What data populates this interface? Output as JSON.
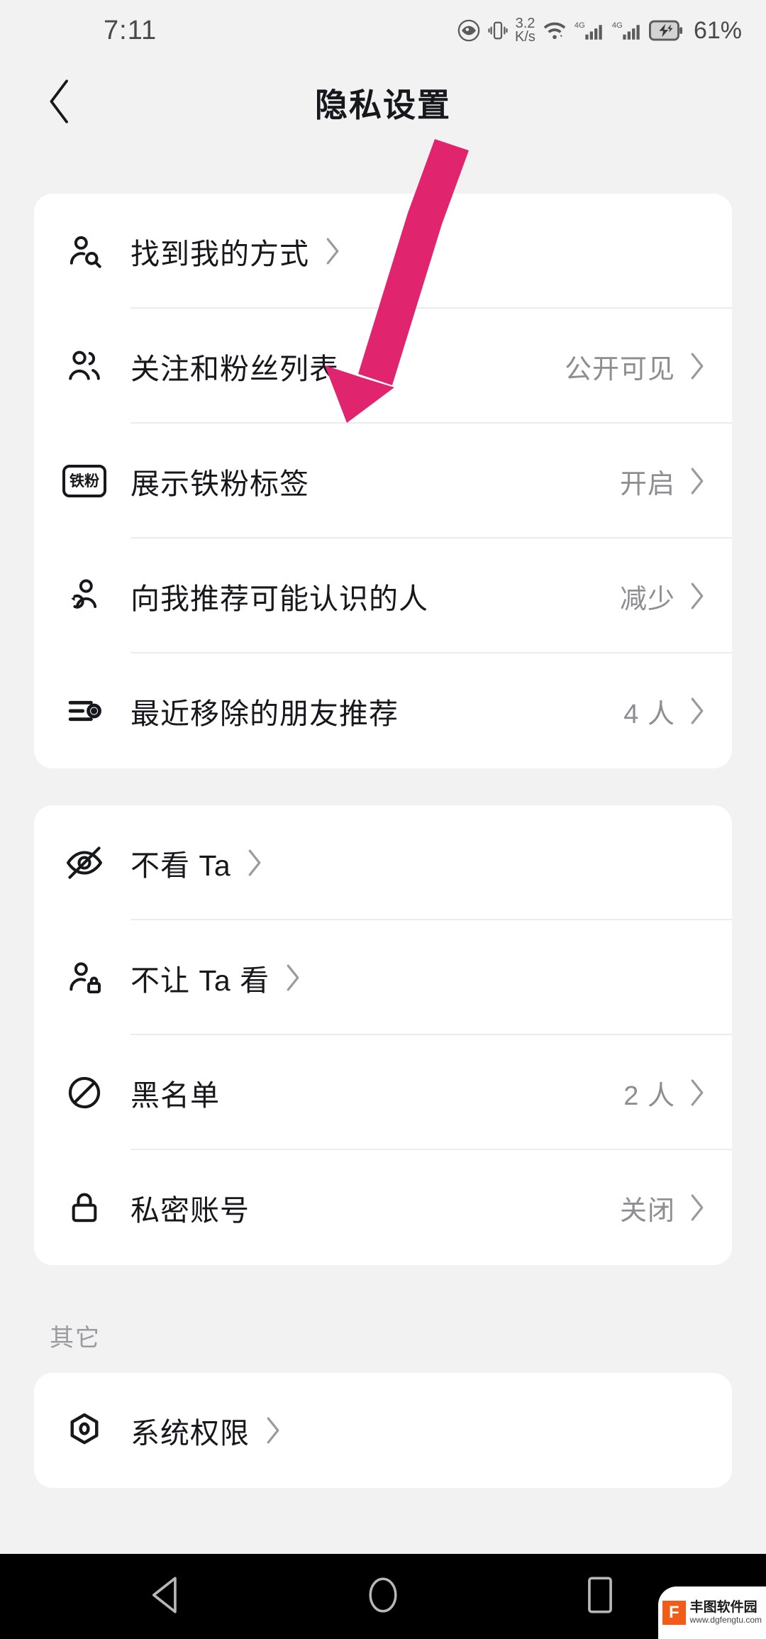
{
  "status_bar": {
    "time": "7:11",
    "net_speed_value": "3.2",
    "net_speed_unit": "K/s",
    "battery_percent": "61%",
    "icons": [
      "eye-icon",
      "vibrate-icon",
      "wifi-icon",
      "signal-4g-icon",
      "signal-4g-icon",
      "battery-charging-icon"
    ]
  },
  "header": {
    "title": "隐私设置",
    "back_icon": "chevron-left-icon"
  },
  "sections": [
    {
      "id": "privacy-main",
      "rows": [
        {
          "icon": "person-search-icon",
          "label": "找到我的方式",
          "value": ""
        },
        {
          "icon": "people-group-icon",
          "label": "关注和粉丝列表",
          "value": "公开可见"
        },
        {
          "icon": "fan-badge-icon",
          "label": "展示铁粉标签",
          "value": "开启",
          "badge_text": "铁粉"
        },
        {
          "icon": "person-suggest-icon",
          "label": "向我推荐可能认识的人",
          "value": "减少"
        },
        {
          "icon": "filter-list-icon",
          "label": "最近移除的朋友推荐",
          "value": "4 人"
        }
      ]
    },
    {
      "id": "visibility",
      "rows": [
        {
          "icon": "eye-off-icon",
          "label": "不看 Ta",
          "value": ""
        },
        {
          "icon": "person-lock-icon",
          "label": "不让 Ta 看",
          "value": ""
        },
        {
          "icon": "ban-icon",
          "label": "黑名单",
          "value": "2 人"
        },
        {
          "icon": "lock-icon",
          "label": "私密账号",
          "value": "关闭"
        }
      ]
    },
    {
      "id": "other",
      "header_label": "其它",
      "rows": [
        {
          "icon": "hex-nut-icon",
          "label": "系统权限",
          "value": ""
        }
      ]
    }
  ],
  "annotation": {
    "type": "arrow",
    "color": "#e0246e",
    "points_to": "向我推荐可能认识的人"
  },
  "nav_bar": {
    "back_icon": "triangle-back-icon",
    "home_icon": "circle-home-icon",
    "recents_icon": "square-recents-icon"
  },
  "watermark": {
    "logo_letter": "F",
    "name": "丰图软件园",
    "url": "www.dgfengtu.com"
  },
  "colors": {
    "page_bg": "#f2f2f2",
    "card_bg": "#ffffff",
    "text_primary": "#17181c",
    "text_secondary": "#8d8d92",
    "divider": "#ececec",
    "accent_arrow": "#e0246e",
    "nav_bg": "#000000"
  }
}
